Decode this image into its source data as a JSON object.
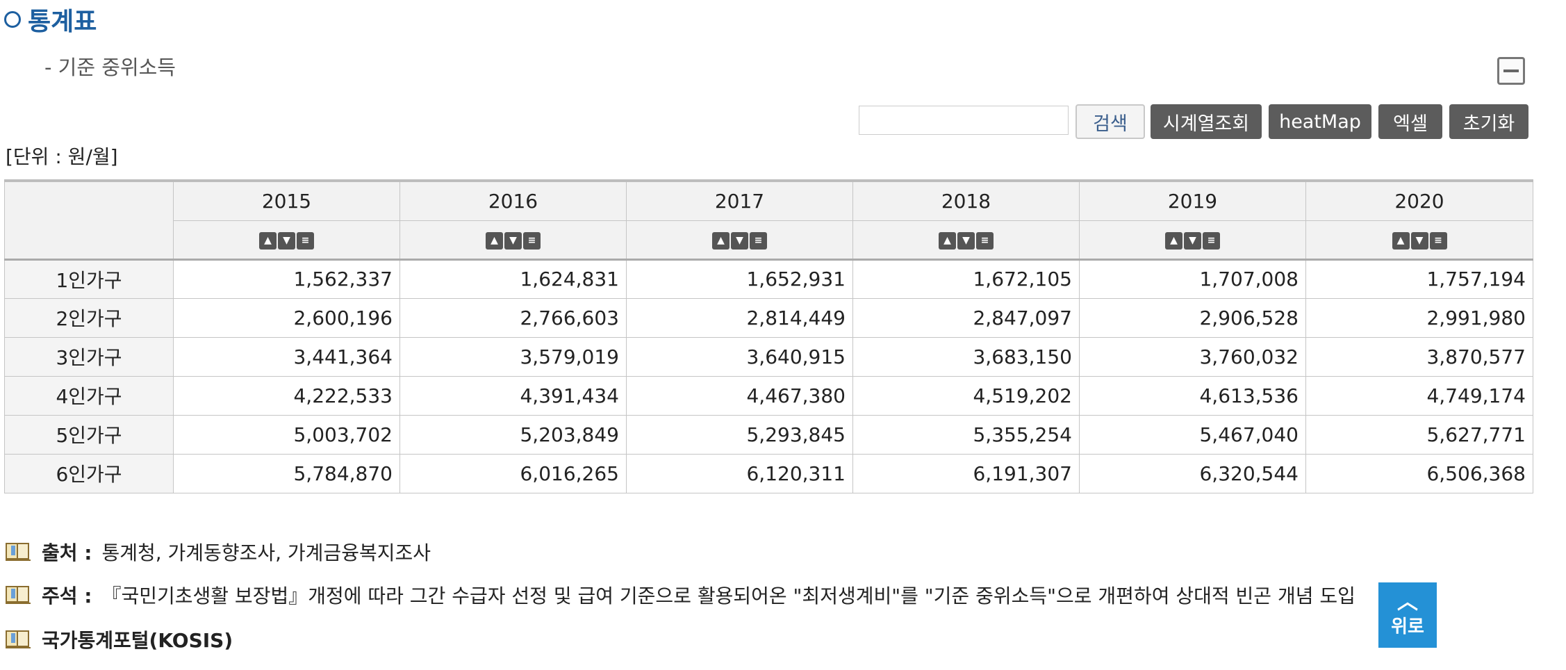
{
  "header": {
    "title": "통계표",
    "subtitle": "- 기준 중위소득"
  },
  "toolbar": {
    "search_placeholder": "",
    "search_label": "검색",
    "timeseries_label": "시계열조회",
    "heatmap_label": "heatMap",
    "excel_label": "엑셀",
    "reset_label": "초기화"
  },
  "unit": "[단위 : 원/월]",
  "table": {
    "columns": [
      "2015",
      "2016",
      "2017",
      "2018",
      "2019",
      "2020"
    ],
    "rows": [
      {
        "label": "1인가구",
        "values": [
          "1,562,337",
          "1,624,831",
          "1,652,931",
          "1,672,105",
          "1,707,008",
          "1,757,194"
        ]
      },
      {
        "label": "2인가구",
        "values": [
          "2,600,196",
          "2,766,603",
          "2,814,449",
          "2,847,097",
          "2,906,528",
          "2,991,980"
        ]
      },
      {
        "label": "3인가구",
        "values": [
          "3,441,364",
          "3,579,019",
          "3,640,915",
          "3,683,150",
          "3,760,032",
          "3,870,577"
        ]
      },
      {
        "label": "4인가구",
        "values": [
          "4,222,533",
          "4,391,434",
          "4,467,380",
          "4,519,202",
          "4,613,536",
          "4,749,174"
        ]
      },
      {
        "label": "5인가구",
        "values": [
          "5,003,702",
          "5,203,849",
          "5,293,845",
          "5,355,254",
          "5,467,040",
          "5,627,771"
        ]
      },
      {
        "label": "6인가구",
        "values": [
          "5,784,870",
          "6,016,265",
          "6,120,311",
          "6,191,307",
          "6,320,544",
          "6,506,368"
        ]
      }
    ]
  },
  "notes": {
    "source_label": "출처 :",
    "source_text": "통계청, 가계동향조사, 가계금융복지조사",
    "comment_label": "주석 :",
    "comment_text": "『국민기초생활 보장법』개정에 따라 그간 수급자 선정 및 급여 기준으로 활용되어온 \"최저생계비\"를 \"기준 중위소득\"으로 개편하여 상대적 빈곤 개념 도입",
    "kosis_label": "국가통계포털(KOSIS)"
  },
  "top_button_label": "위로",
  "colors": {
    "title": "#1d5fa0",
    "dark_button": "#5c5c5c",
    "top_button": "#2491d6"
  }
}
